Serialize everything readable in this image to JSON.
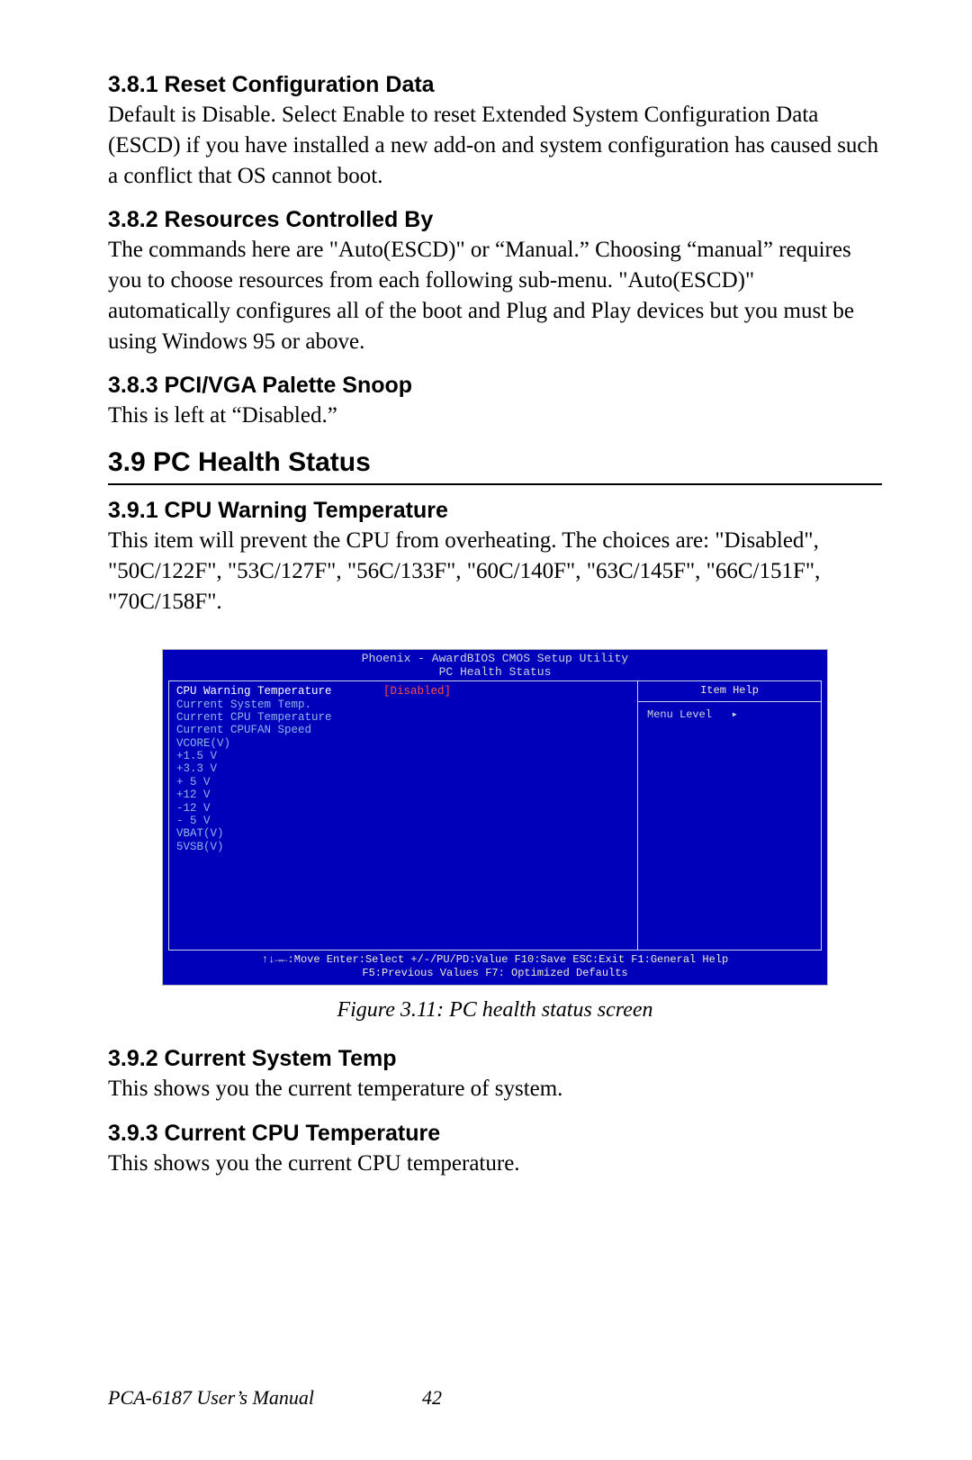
{
  "sections": {
    "s381": {
      "heading": "3.8.1 Reset Configuration Data",
      "body": "Default is Disable. Select Enable to reset Extended System Configuration Data (ESCD) if you have installed a new add-on and system configuration has caused such a conflict that OS cannot boot."
    },
    "s382": {
      "heading": "3.8.2 Resources Controlled By",
      "body": "The commands here are \"Auto(ESCD)\" or “Manual.” Choosing “manual” requires you to choose resources from each following sub-menu. \"Auto(ESCD)\" automatically configures all of the boot and Plug and Play devices but you must be using Windows 95 or above."
    },
    "s383": {
      "heading": "3.8.3 PCI/VGA Palette Snoop",
      "body": "This is left at “Disabled.”"
    },
    "s39": {
      "heading": "3.9  PC Health Status"
    },
    "s391": {
      "heading": "3.9.1 CPU Warning Temperature",
      "body": "This item will prevent the CPU from overheating. The choices are: \"Disabled\", \"50C/122F\", \"53C/127F\", \"56C/133F\", \"60C/140F\", \"63C/145F\", \"66C/151F\", \"70C/158F\"."
    },
    "s392": {
      "heading": "3.9.2 Current System Temp",
      "body": "This shows you the current temperature of system."
    },
    "s393": {
      "heading": "3.9.3 Current CPU Temperature",
      "body": "This shows you the current CPU temperature."
    }
  },
  "bios": {
    "title1": "Phoenix - AwardBIOS CMOS Setup Utility",
    "title2": "PC Health Status",
    "rows": [
      {
        "label": "CPU Warning Temperature",
        "value": "[Disabled]",
        "hi": true
      },
      {
        "label": "Current System Temp.",
        "value": ""
      },
      {
        "label": "Current CPU Temperature",
        "value": ""
      },
      {
        "label": "Current CPUFAN Speed",
        "value": ""
      },
      {
        "label": "VCORE(V)",
        "value": ""
      },
      {
        "label": "+1.5 V",
        "value": ""
      },
      {
        "label": "+3.3 V",
        "value": ""
      },
      {
        "label": "+ 5 V",
        "value": ""
      },
      {
        "label": "+12 V",
        "value": ""
      },
      {
        "label": "-12 V",
        "value": ""
      },
      {
        "label": "- 5 V",
        "value": ""
      },
      {
        "label": "VBAT(V)",
        "value": ""
      },
      {
        "label": "5VSB(V)",
        "value": ""
      }
    ],
    "help_head": "Item Help",
    "help_menu": "Menu Level",
    "footer1": "↑↓→←:Move  Enter:Select  +/-/PU/PD:Value  F10:Save  ESC:Exit  F1:General Help",
    "footer2": "F5:Previous Values          F7: Optimized Defaults"
  },
  "caption": "Figure 3.11: PC health status screen",
  "footer": {
    "manual": "PCA-6187 User’s Manual",
    "page": "42"
  }
}
